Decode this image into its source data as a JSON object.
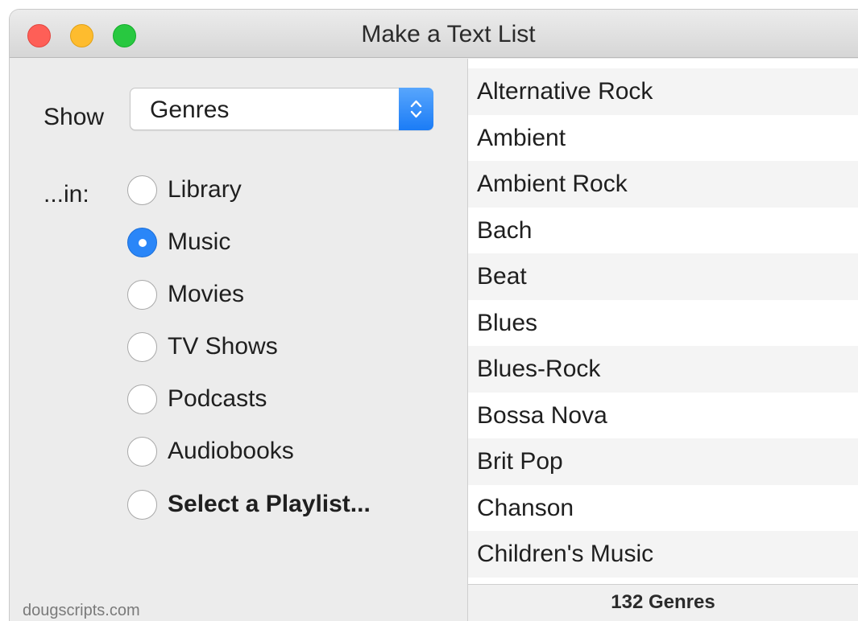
{
  "window": {
    "title": "Make a Text List"
  },
  "show": {
    "label": "Show",
    "selected": "Genres"
  },
  "in": {
    "label": "...in:",
    "options": [
      {
        "label": "Library",
        "checked": false,
        "bold": false
      },
      {
        "label": "Music",
        "checked": true,
        "bold": false
      },
      {
        "label": "Movies",
        "checked": false,
        "bold": false
      },
      {
        "label": "TV Shows",
        "checked": false,
        "bold": false
      },
      {
        "label": "Podcasts",
        "checked": false,
        "bold": false
      },
      {
        "label": "Audiobooks",
        "checked": false,
        "bold": false
      },
      {
        "label": "Select a Playlist...",
        "checked": false,
        "bold": true
      }
    ]
  },
  "footer_credit": "dougscripts.com",
  "list": {
    "items": [
      "Alternative Rock",
      "Ambient",
      "Ambient Rock",
      "Bach",
      "Beat",
      "Blues",
      "Blues-Rock",
      "Bossa Nova",
      "Brit Pop",
      "Chanson",
      "Children's Music"
    ],
    "count_label": "132 Genres"
  },
  "icons": {
    "popup_indicator": "chevron-up-down-icon",
    "radio": "radio-button-icon"
  },
  "colors": {
    "accent": "#2a86f8",
    "close": "#fe5f57",
    "minimize": "#febc2e",
    "zoom": "#28c840"
  }
}
